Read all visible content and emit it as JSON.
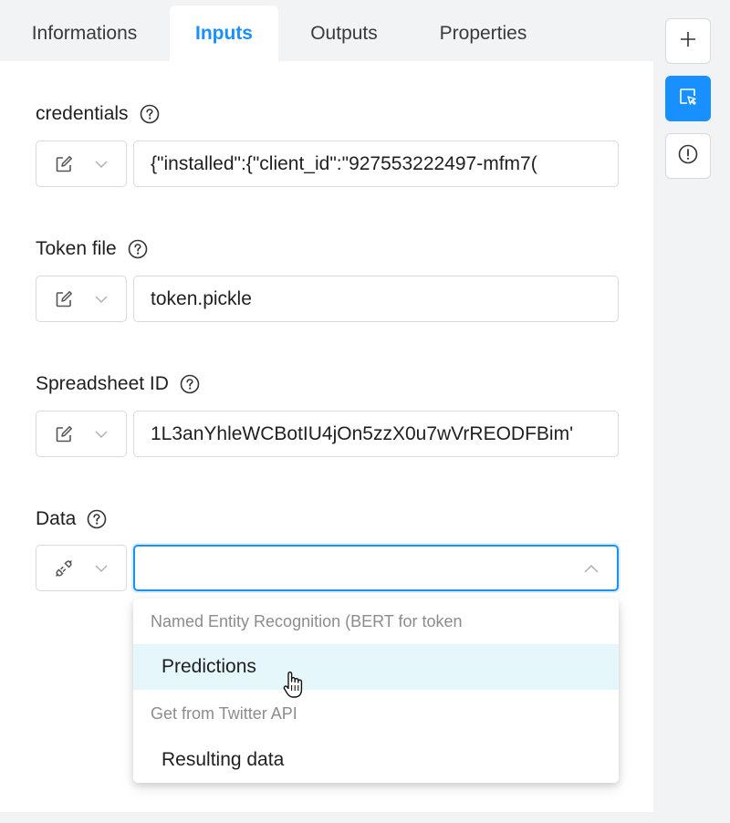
{
  "tabs": [
    {
      "label": "Informations",
      "active": false
    },
    {
      "label": "Inputs",
      "active": true
    },
    {
      "label": "Outputs",
      "active": false
    },
    {
      "label": "Properties",
      "active": false
    }
  ],
  "fields": {
    "credentials": {
      "label": "credentials",
      "mode_icon": "edit-icon",
      "value": "{\"installed\":{\"client_id\":\"927553222497-mfm7("
    },
    "token_file": {
      "label": "Token file",
      "mode_icon": "edit-icon",
      "value": "token.pickle"
    },
    "spreadsheet_id": {
      "label": "Spreadsheet ID",
      "mode_icon": "edit-icon",
      "value": "1L3anYhleWCBotIU4jOn5zzX0u7wVrREODFBim'"
    },
    "data": {
      "label": "Data",
      "mode_icon": "link-icon",
      "value": ""
    }
  },
  "dropdown": {
    "groups": [
      {
        "title": "Named Entity Recognition (BERT for token",
        "options": [
          {
            "label": "Predictions",
            "highlighted": true
          }
        ]
      },
      {
        "title": "Get from Twitter API",
        "options": [
          {
            "label": "Resulting data",
            "highlighted": false
          }
        ]
      }
    ]
  },
  "side_buttons": [
    {
      "icon": "plus-icon"
    },
    {
      "icon": "select-cursor-icon",
      "active": true
    },
    {
      "icon": "info-circle-icon"
    }
  ],
  "colors": {
    "accent": "#1890ff",
    "highlight": "#e6f7fb"
  }
}
